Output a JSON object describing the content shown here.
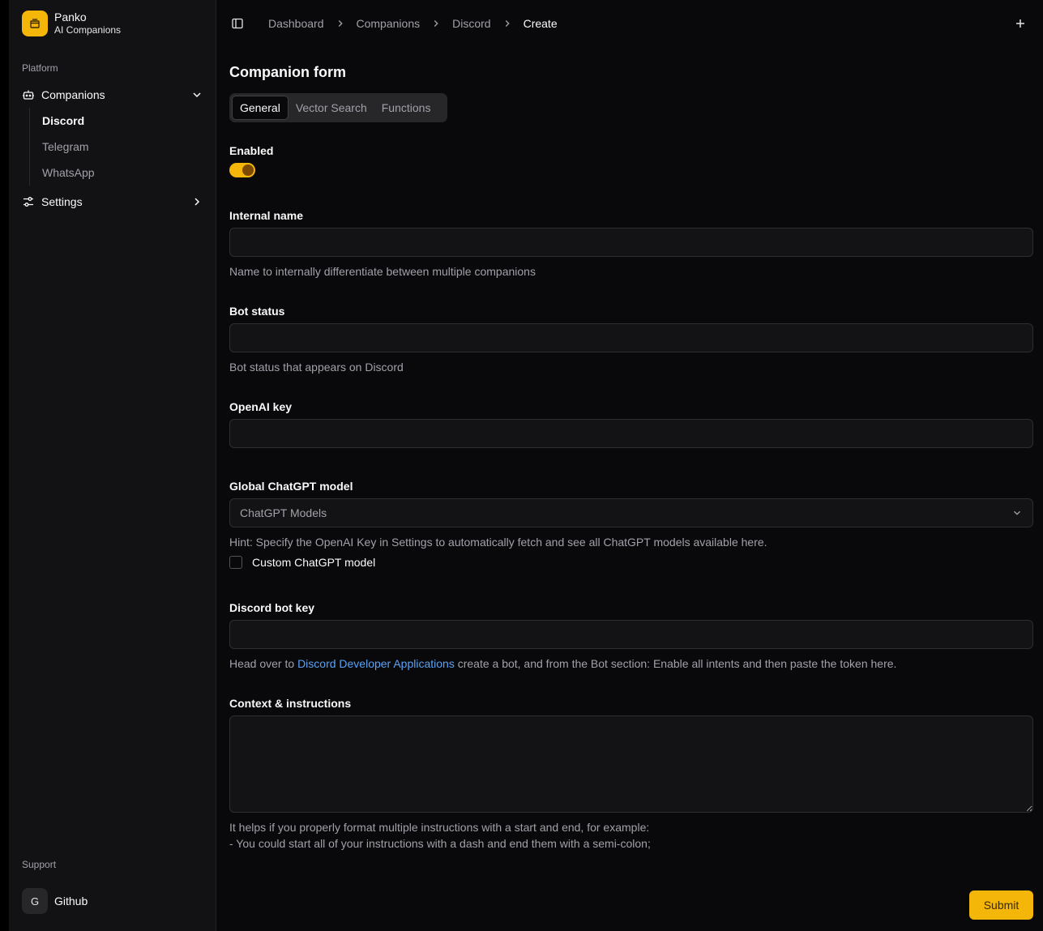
{
  "brand": {
    "name": "Panko",
    "subtitle": "AI Companions"
  },
  "sidebar": {
    "group_platform": "Platform",
    "companions_label": "Companions",
    "sub_items": [
      "Discord",
      "Telegram",
      "WhatsApp"
    ],
    "settings_label": "Settings",
    "group_support": "Support",
    "support_avatar": "G",
    "support_label": "Github"
  },
  "breadcrumbs": [
    "Dashboard",
    "Companions",
    "Discord",
    "Create"
  ],
  "form": {
    "title": "Companion form",
    "tabs": [
      "General",
      "Vector Search",
      "Functions"
    ],
    "enabled_label": "Enabled",
    "enabled": true,
    "internal_name_label": "Internal name",
    "internal_name_value": "",
    "internal_name_hint": "Name to internally differentiate between multiple companions",
    "bot_status_label": "Bot status",
    "bot_status_value": "",
    "bot_status_hint": "Bot status that appears on Discord",
    "openai_key_label": "OpenAI key",
    "openai_key_value": "",
    "model_label": "Global ChatGPT model",
    "model_selected": "ChatGPT Models",
    "model_hint": "Hint: Specify the OpenAI Key in Settings to automatically fetch and see all ChatGPT models available here.",
    "custom_model_label": "Custom ChatGPT model",
    "discord_key_label": "Discord bot key",
    "discord_key_value": "",
    "discord_hint_pre": "Head over to ",
    "discord_hint_link": "Discord Developer Applications",
    "discord_hint_post": " create a bot, and from the Bot section: Enable all intents and then paste the token here.",
    "context_label": "Context & instructions",
    "context_value": "",
    "context_hint_1": "It helps if you properly format multiple instructions with a start and end, for example:",
    "context_hint_2": "- You could start all of your instructions with a dash and end them with a semi-colon;",
    "submit_label": "Submit"
  },
  "colors": {
    "accent": "#f5b60a",
    "background": "#09090b",
    "sidebar": "#121214",
    "link": "#5aa2f5"
  },
  "icons": {
    "brand": "store-icon",
    "companions": "bot-icon",
    "settings": "sliders-icon",
    "sidebar_toggle": "panel-left-icon",
    "new": "plus-icon"
  }
}
